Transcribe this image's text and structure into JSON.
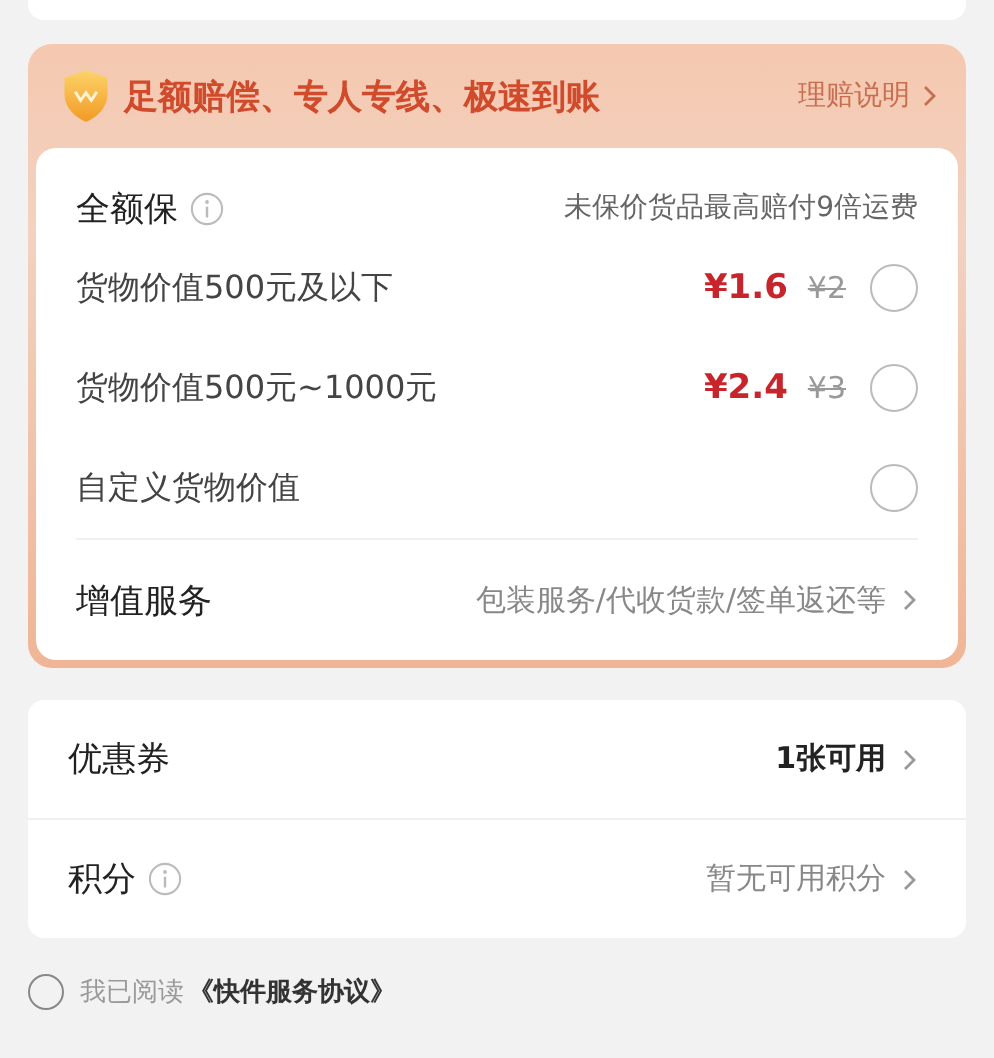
{
  "insurance": {
    "banner_title": "足额赔偿、专人专线、极速到账",
    "claim_link": "理赔说明",
    "plan_title": "全额保",
    "plan_note": "未保价货品最高赔付9倍运费",
    "options": [
      {
        "label": "货物价值500元及以下",
        "price": "¥1.6",
        "original_price": "¥2",
        "selected": false
      },
      {
        "label": "货物价值500元~1000元",
        "price": "¥2.4",
        "original_price": "¥3",
        "selected": false
      },
      {
        "label": "自定义货物价值",
        "selected": false
      }
    ],
    "value_added": {
      "label": "增值服务",
      "value": "包装服务/代收货款/签单返还等"
    }
  },
  "discounts": [
    {
      "kind": "coupon",
      "label": "优惠券",
      "value": "1张可用"
    },
    {
      "kind": "points",
      "label": "积分",
      "value": "暂无可用积分"
    }
  ],
  "agreement": {
    "text": "我已阅读",
    "link": "《快件服务协议》",
    "checked": false
  }
}
